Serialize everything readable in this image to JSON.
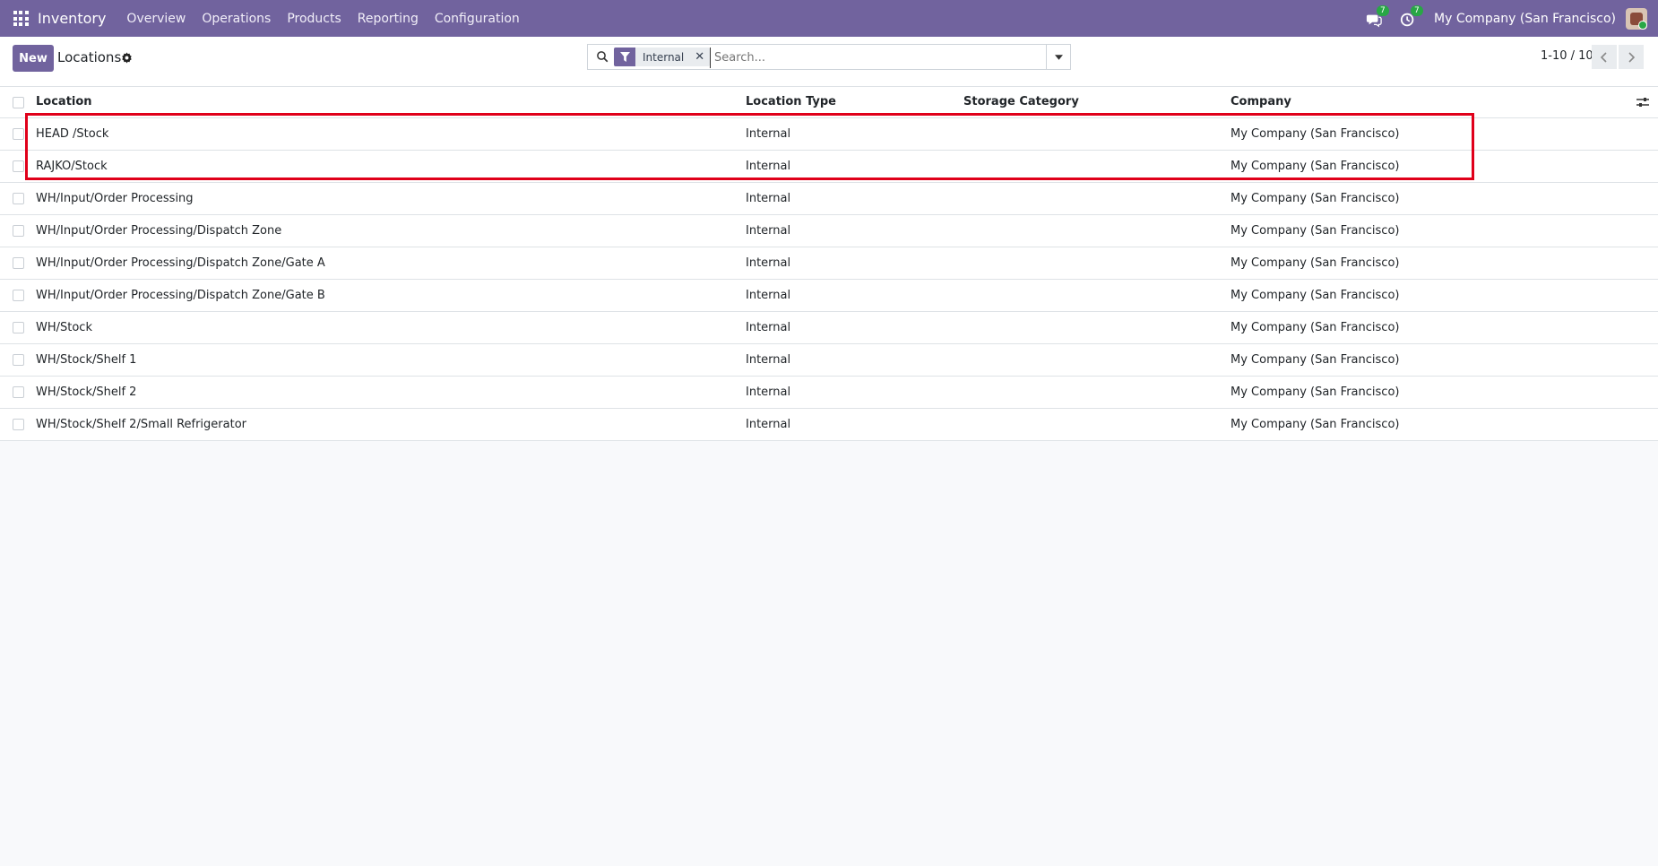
{
  "navbar": {
    "app_name": "Inventory",
    "menu": [
      "Overview",
      "Operations",
      "Products",
      "Reporting",
      "Configuration"
    ],
    "messages_count": "7",
    "activities_count": "7",
    "company": "My Company (San Francisco)"
  },
  "control_panel": {
    "new_label": "New",
    "title": "Locations",
    "search": {
      "facet_label": "Internal",
      "facet_icon": "filter-icon",
      "placeholder": "Search..."
    },
    "pager": "1-10 / 10"
  },
  "list": {
    "columns": {
      "location": "Location",
      "location_type": "Location Type",
      "storage_category": "Storage Category",
      "company": "Company"
    },
    "rows": [
      {
        "location": "HEAD /Stock",
        "type": "Internal",
        "storage": "",
        "company": "My Company (San Francisco)"
      },
      {
        "location": "RAJKO/Stock",
        "type": "Internal",
        "storage": "",
        "company": "My Company (San Francisco)"
      },
      {
        "location": "WH/Input/Order Processing",
        "type": "Internal",
        "storage": "",
        "company": "My Company (San Francisco)"
      },
      {
        "location": "WH/Input/Order Processing/Dispatch Zone",
        "type": "Internal",
        "storage": "",
        "company": "My Company (San Francisco)"
      },
      {
        "location": "WH/Input/Order Processing/Dispatch Zone/Gate A",
        "type": "Internal",
        "storage": "",
        "company": "My Company (San Francisco)"
      },
      {
        "location": "WH/Input/Order Processing/Dispatch Zone/Gate B",
        "type": "Internal",
        "storage": "",
        "company": "My Company (San Francisco)"
      },
      {
        "location": "WH/Stock",
        "type": "Internal",
        "storage": "",
        "company": "My Company (San Francisco)"
      },
      {
        "location": "WH/Stock/Shelf 1",
        "type": "Internal",
        "storage": "",
        "company": "My Company (San Francisco)"
      },
      {
        "location": "WH/Stock/Shelf 2",
        "type": "Internal",
        "storage": "",
        "company": "My Company (San Francisco)"
      },
      {
        "location": "WH/Stock/Shelf 2/Small Refrigerator",
        "type": "Internal",
        "storage": "",
        "company": "My Company (San Francisco)"
      }
    ]
  },
  "colors": {
    "brand": "#71639e",
    "highlight_border": "#e0001a",
    "badge": "#28a745"
  }
}
